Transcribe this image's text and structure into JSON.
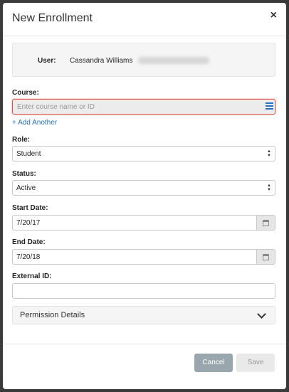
{
  "modal": {
    "title": "New Enrollment",
    "close_symbol": "×"
  },
  "user": {
    "label": "User:",
    "name": "Cassandra Williams"
  },
  "course": {
    "label": "Course:",
    "placeholder": "Enter course name or ID",
    "value": "",
    "add_another": "+ Add Another"
  },
  "role": {
    "label": "Role:",
    "selected": "Student"
  },
  "status": {
    "label": "Status:",
    "selected": "Active"
  },
  "start_date": {
    "label": "Start Date:",
    "value": "7/20/17"
  },
  "end_date": {
    "label": "End Date:",
    "value": "7/20/18"
  },
  "external_id": {
    "label": "External ID:",
    "value": ""
  },
  "permissions": {
    "label": "Permission Details"
  },
  "buttons": {
    "cancel": "Cancel",
    "save": "Save"
  },
  "colors": {
    "link": "#2a6ebd",
    "error_border": "#d9534f",
    "cancel_bg": "#9aa6ad"
  }
}
